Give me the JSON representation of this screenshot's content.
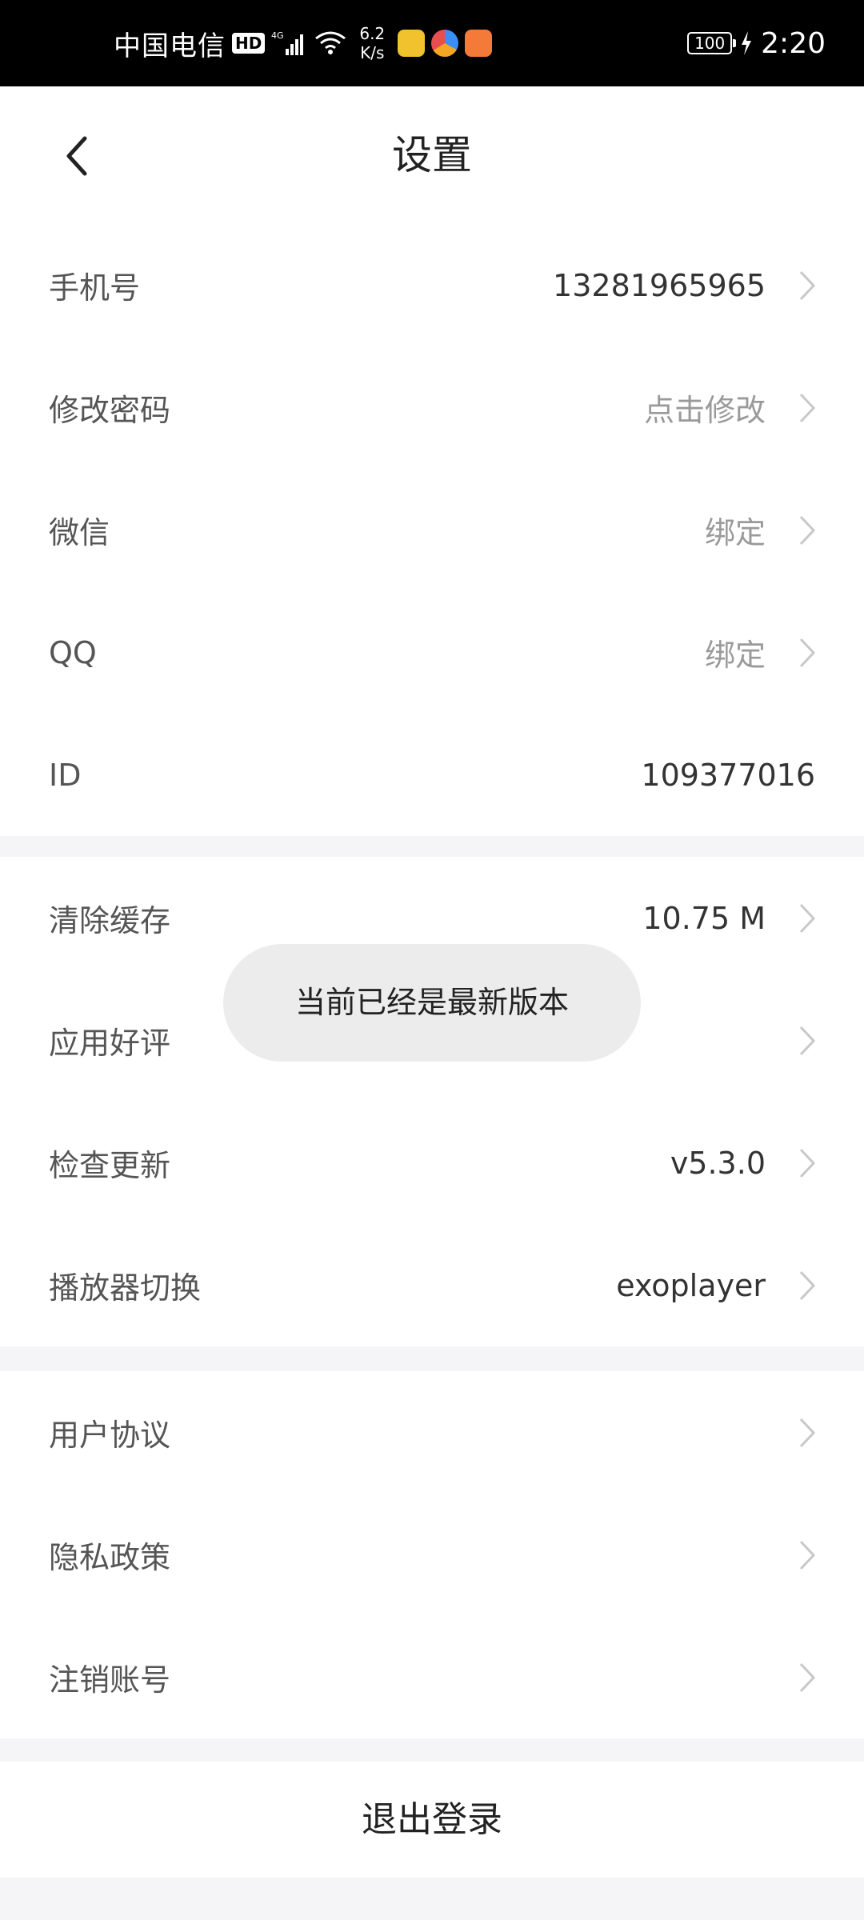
{
  "status_bar": {
    "carrier": "中国电信",
    "hd": "HD",
    "network": "4G",
    "speed_value": "6.2",
    "speed_unit": "K/s",
    "battery": "100",
    "time": "2:20"
  },
  "header": {
    "title": "设置"
  },
  "account_section": {
    "rows": [
      {
        "label": "手机号",
        "value": "13281965965"
      },
      {
        "label": "修改密码",
        "value": "点击修改"
      },
      {
        "label": "微信",
        "value": "绑定"
      },
      {
        "label": "QQ",
        "value": "绑定"
      },
      {
        "label": "ID",
        "value": "109377016"
      }
    ]
  },
  "app_section": {
    "rows": [
      {
        "label": "清除缓存",
        "value": "10.75 M"
      },
      {
        "label": "应用好评",
        "value": ""
      },
      {
        "label": "检查更新",
        "value": "v5.3.0"
      },
      {
        "label": "播放器切换",
        "value": "exoplayer"
      }
    ]
  },
  "legal_section": {
    "rows": [
      {
        "label": "用户协议"
      },
      {
        "label": "隐私政策"
      },
      {
        "label": "注销账号"
      }
    ]
  },
  "logout": {
    "label": "退出登录"
  },
  "toast": {
    "message": "当前已经是最新版本"
  },
  "colors": {
    "accent": "#f47a3a",
    "background": "#f5f5f7",
    "toast": "#ececec"
  }
}
